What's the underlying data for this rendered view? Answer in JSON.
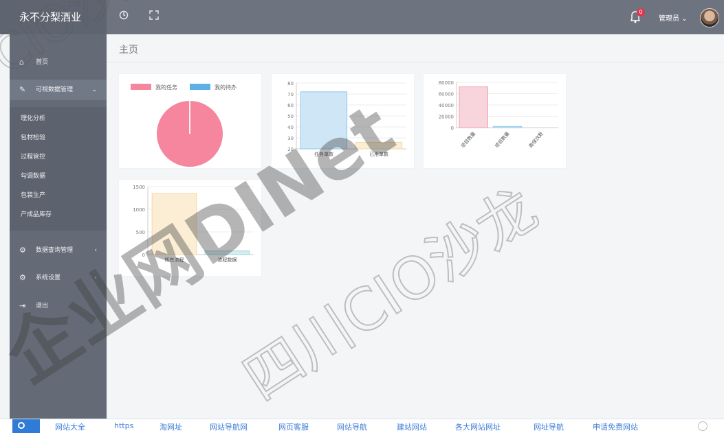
{
  "header": {
    "brand": "永不分梨酒业",
    "notification_count": "0",
    "user_label": "管理员 ⌄"
  },
  "sidebar": {
    "home": "首页",
    "data_entry": "可视数据管理",
    "sub_items": [
      "理化分析",
      "包材检验",
      "过程管控",
      "勾调数据",
      "包装生产",
      "产成品库存"
    ],
    "query": "数据查询管理",
    "settings": "系统设置",
    "logout": "退出"
  },
  "main": {
    "page_title": "主页"
  },
  "chart_data": [
    {
      "type": "pie",
      "legend": [
        "我的任务",
        "我的待办"
      ],
      "values": [
        1,
        0
      ],
      "colors": [
        "#f5869e",
        "#5cb0e6"
      ]
    },
    {
      "type": "bar",
      "categories": [
        "任务单数",
        "已用单数"
      ],
      "values": [
        72,
        26
      ],
      "ylim": [
        20,
        80
      ],
      "yticks": [
        20,
        30,
        40,
        50,
        60,
        70,
        80
      ],
      "colors": [
        "#cfe6f6",
        "#fbeed4"
      ]
    },
    {
      "type": "bar",
      "categories": [
        "项目数量",
        "项目数量",
        "周保次数"
      ],
      "values": [
        72000,
        2000,
        0
      ],
      "ylim": [
        0,
        80000
      ],
      "yticks": [
        0,
        20000,
        40000,
        60000,
        80000
      ],
      "colors": [
        "#f8d5dc",
        "#cfe6f6",
        "#fbeed4"
      ]
    },
    {
      "type": "bar",
      "categories": [
        "所有流程",
        "流程数据"
      ],
      "values": [
        1350,
        80
      ],
      "ylim": [
        0,
        1500
      ],
      "yticks": [
        0,
        500,
        1000,
        1500
      ],
      "colors": [
        "#fbeed4",
        "#d6eef0"
      ]
    }
  ],
  "bottom_links": [
    "网站大全",
    "https",
    "淘网址",
    "网站导航网",
    "网页客服",
    "网站导航",
    "建站网站",
    "各大网站网址",
    "网址导航",
    "申请免费网站"
  ],
  "watermark": [
    "企业网DINet",
    "四川CIO沙龙",
    "CIO沙龙"
  ]
}
